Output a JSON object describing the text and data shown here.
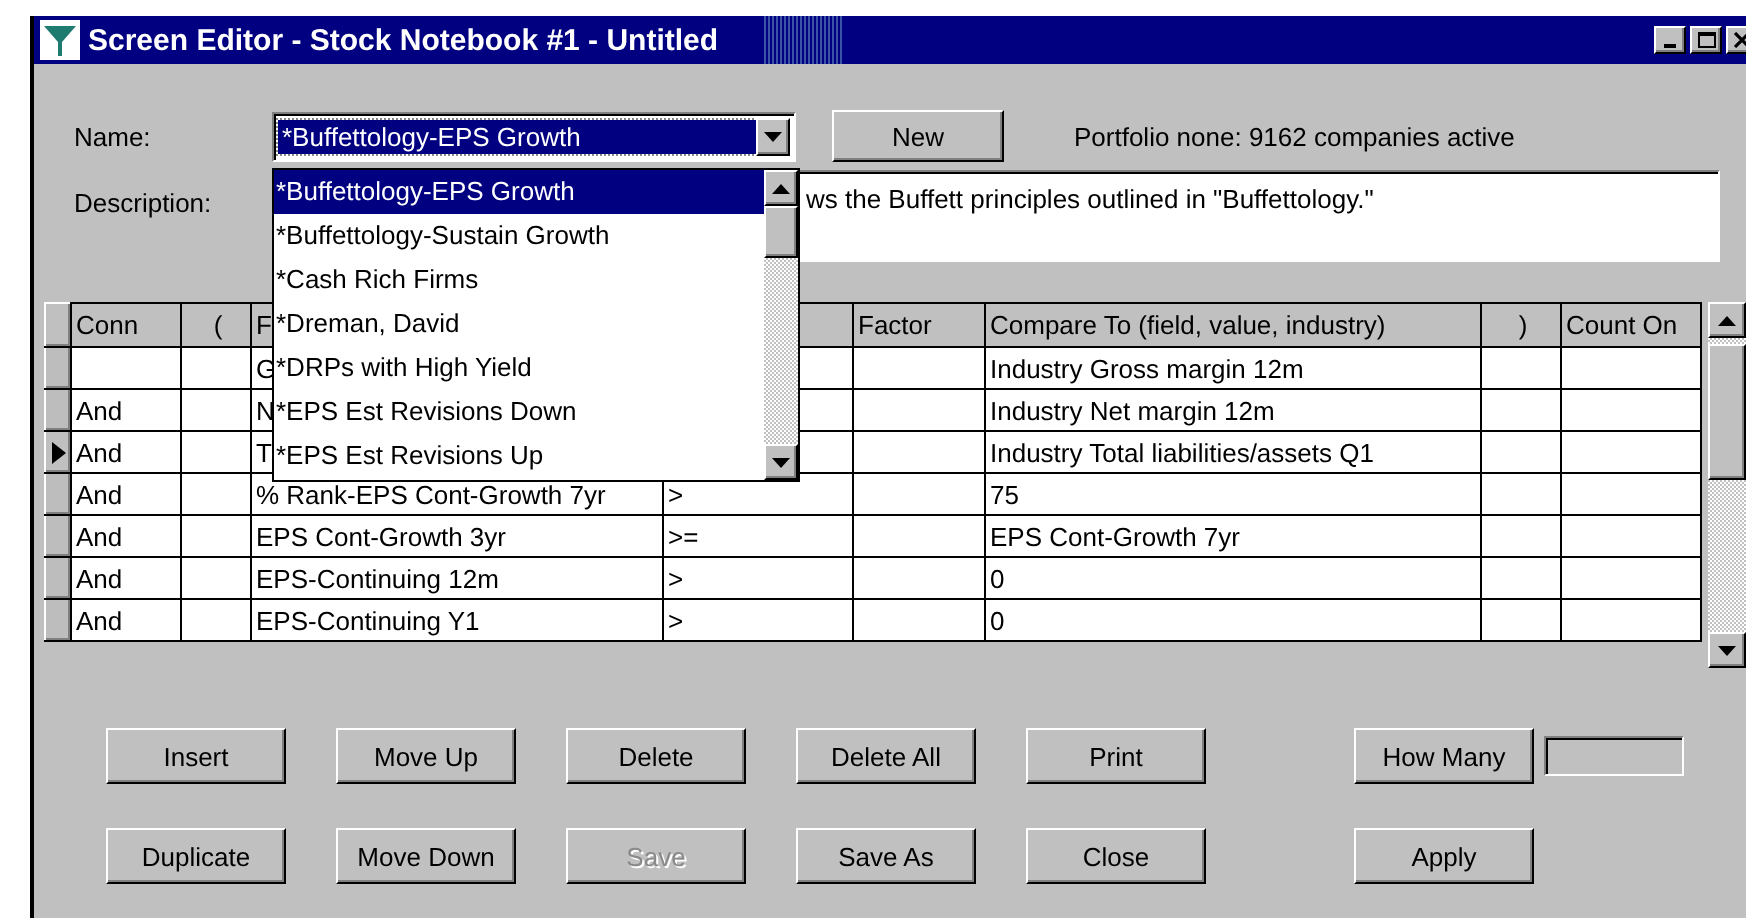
{
  "window": {
    "title": "Screen Editor - Stock Notebook #1 - Untitled"
  },
  "name_field": {
    "label": "Name:",
    "value": "*Buffettology-EPS Growth",
    "selected": true
  },
  "new_button": {
    "label": "New"
  },
  "status": "Portfolio none: 9162 companies active",
  "description": {
    "label": "Description:",
    "value": "ws the Buffett principles outlined in \"Buffettology.\""
  },
  "name_dropdown": {
    "items": [
      {
        "label": "*Buffettology-EPS Growth",
        "selected": true
      },
      {
        "label": "*Buffettology-Sustain Growth",
        "selected": false
      },
      {
        "label": "*Cash Rich Firms",
        "selected": false
      },
      {
        "label": "*Dreman, David",
        "selected": false
      },
      {
        "label": "*DRPs with High Yield",
        "selected": false
      },
      {
        "label": "*EPS Est Revisions Down",
        "selected": false
      },
      {
        "label": "*EPS Est Revisions Up",
        "selected": false
      }
    ]
  },
  "table": {
    "columns": [
      "Conn",
      "(",
      "F",
      null,
      "Factor",
      "Compare To (field, value, industry)",
      ")",
      "Count On"
    ],
    "rows": [
      {
        "current": false,
        "cells": [
          null,
          null,
          "G",
          null,
          null,
          "Industry Gross margin 12m",
          null,
          null
        ]
      },
      {
        "current": false,
        "cells": [
          "And",
          null,
          "N",
          null,
          null,
          "Industry Net margin 12m",
          null,
          null
        ]
      },
      {
        "current": true,
        "cells": [
          "And",
          null,
          "T",
          null,
          null,
          "Industry Total liabilities/assets Q1",
          null,
          null
        ]
      },
      {
        "current": false,
        "cells": [
          "And",
          null,
          "% Rank-EPS Cont-Growth 7yr",
          ">",
          null,
          "75",
          null,
          null
        ]
      },
      {
        "current": false,
        "cells": [
          "And",
          null,
          "EPS Cont-Growth 3yr",
          ">=",
          null,
          "EPS Cont-Growth 7yr",
          null,
          null
        ]
      },
      {
        "current": false,
        "cells": [
          "And",
          null,
          "EPS-Continuing 12m",
          ">",
          null,
          "0",
          null,
          null
        ]
      },
      {
        "current": false,
        "cells": [
          "And",
          null,
          "EPS-Continuing Y1",
          ">",
          null,
          "0",
          null,
          null
        ]
      }
    ]
  },
  "buttons": [
    [
      {
        "label": "Insert",
        "disabled": false
      },
      {
        "label": "Move Up",
        "disabled": false
      },
      {
        "label": "Delete",
        "disabled": false
      },
      {
        "label": "Delete All",
        "disabled": false
      },
      {
        "label": "Print",
        "disabled": false
      },
      {
        "label": "How Many",
        "disabled": false
      }
    ],
    [
      {
        "label": "Duplicate",
        "disabled": false
      },
      {
        "label": "Move Down",
        "disabled": false
      },
      {
        "label": "Save",
        "disabled": true
      },
      {
        "label": "Save As",
        "disabled": false
      },
      {
        "label": "Close",
        "disabled": false
      },
      {
        "label": "Apply",
        "disabled": false
      }
    ]
  ]
}
